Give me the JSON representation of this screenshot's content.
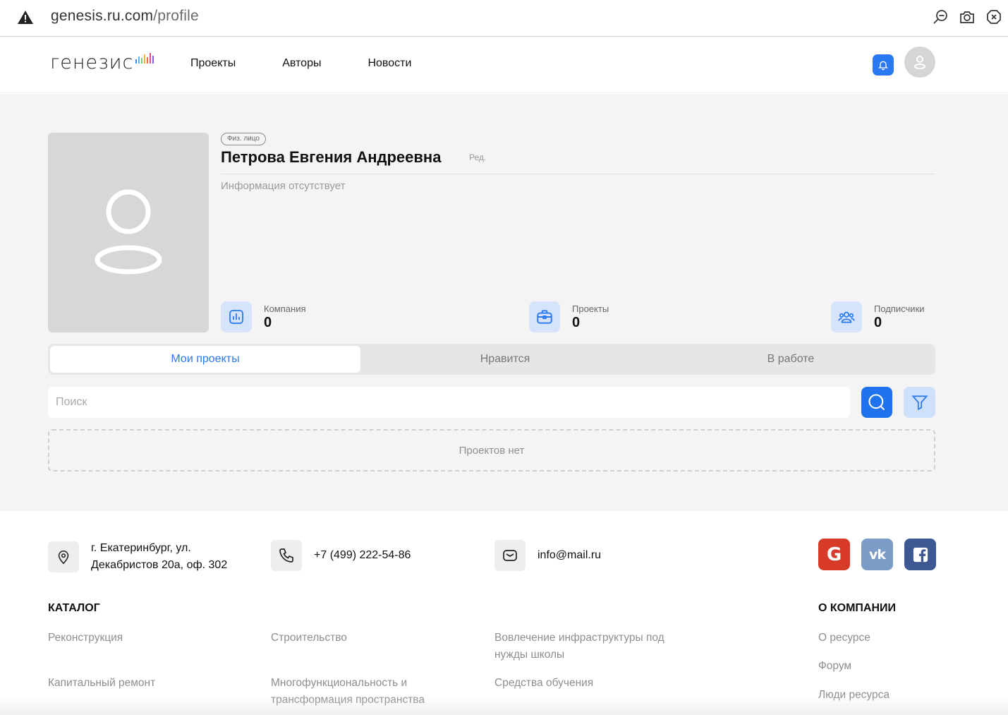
{
  "browser": {
    "url_host": "genesis.ru.com",
    "url_path": "/profile"
  },
  "header": {
    "logo_text": "генезис",
    "nav": [
      "Проекты",
      "Авторы",
      "Новости"
    ]
  },
  "profile": {
    "badge": "Физ. лицо",
    "name": "Петрова Евгения Андреевна",
    "edit_label": "Ред.",
    "info": "Информация отсутствует",
    "stats": [
      {
        "label": "Компания",
        "value": "0"
      },
      {
        "label": "Проекты",
        "value": "0"
      },
      {
        "label": "Подписчики",
        "value": "0"
      }
    ]
  },
  "tabs": [
    "Мои проекты",
    "Нравится",
    "В работе"
  ],
  "search": {
    "placeholder": "Поиск"
  },
  "empty_message": "Проектов нет",
  "footer": {
    "address_line1": "г. Екатеринбург, ул.",
    "address_line2": "Декабристов 20а, оф. 302",
    "phone": "+7 (499) 222-54-86",
    "email": "info@mail.ru",
    "catalog_title": "КАТАЛОГ",
    "catalog_items": [
      "Реконструкция",
      "Строительство",
      "Вовлечение инфраструктуры под нужды школы",
      "Капитальный ремонт",
      "Многофункциональность и трансформация пространства",
      "Средства обучения"
    ],
    "company_title": "О КОМПАНИИ",
    "company_items": [
      "О ресурсе",
      "Форум",
      "Люди ресурса"
    ]
  },
  "colors": {
    "accent": "#2a79f0",
    "google": "#d83a2a",
    "vk": "#7c9cc8",
    "facebook": "#3e5894"
  }
}
